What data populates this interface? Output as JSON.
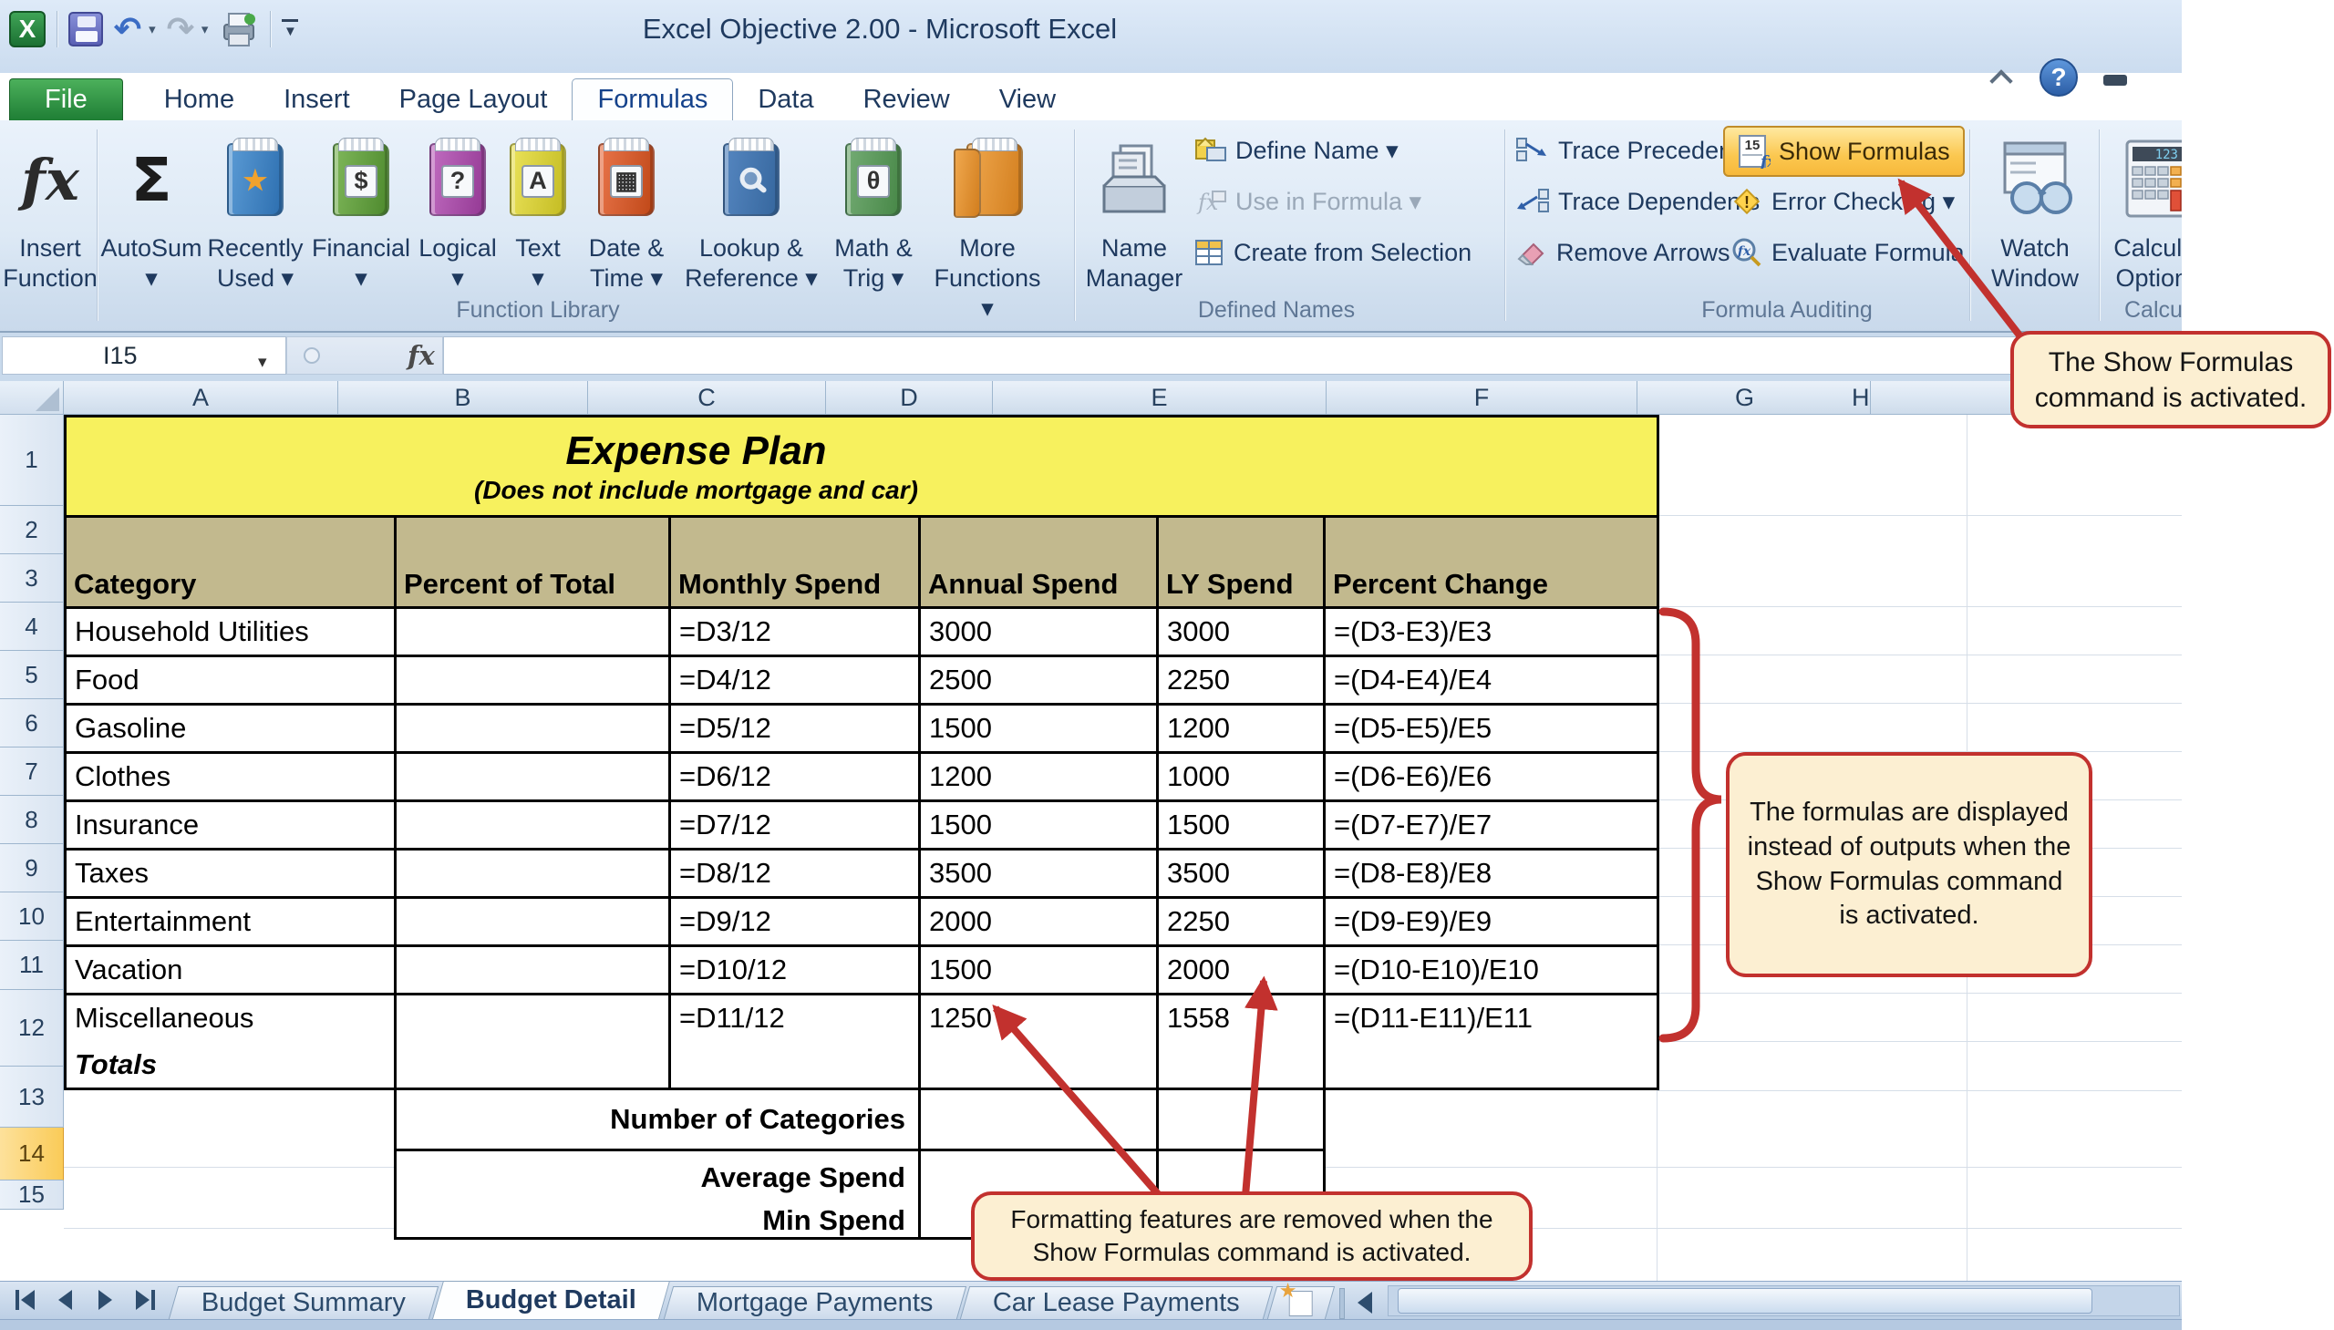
{
  "window": {
    "title": "Excel Objective 2.00  -  Microsoft Excel"
  },
  "qat": {
    "icons": [
      "excel-logo",
      "save",
      "undo",
      "redo",
      "print",
      "customize-quick-access-toolbar"
    ],
    "undo_glyph": "↶",
    "redo_glyph": "↷",
    "dropdown_glyph": "▾",
    "customize_glyph": "▼"
  },
  "ribbon": {
    "tabs": [
      {
        "label": "File",
        "active": false,
        "file": true
      },
      {
        "label": "Home",
        "active": false
      },
      {
        "label": "Insert",
        "active": false
      },
      {
        "label": "Page Layout",
        "active": false
      },
      {
        "label": "Formulas",
        "active": true
      },
      {
        "label": "Data",
        "active": false
      },
      {
        "label": "Review",
        "active": false
      },
      {
        "label": "View",
        "active": false
      }
    ],
    "function_library": {
      "group_label": "Function Library",
      "items": [
        {
          "l1": "Insert",
          "l2": "Function",
          "glyph": "fx",
          "icon": "insert-function-icon"
        },
        {
          "l1": "AutoSum",
          "l2": "▾",
          "glyph": "Σ",
          "icon": "autosum-icon"
        },
        {
          "l1": "Recently",
          "l2": "Used ▾",
          "glyph": "★",
          "icon": "recently-used-book-icon",
          "c1": "#5B9BD5",
          "c2": "#2D6FB0"
        },
        {
          "l1": "Financial",
          "l2": "▾",
          "glyph": "$",
          "icon": "financial-book-icon",
          "c1": "#7FB75A",
          "c2": "#4E8A2E"
        },
        {
          "l1": "Logical",
          "l2": "▾",
          "glyph": "?",
          "icon": "logical-book-icon",
          "c1": "#C06CC0",
          "c2": "#943994"
        },
        {
          "l1": "Text",
          "l2": "▾",
          "glyph": "A",
          "icon": "text-book-icon",
          "c1": "#EAE25A",
          "c2": "#C4BC22"
        },
        {
          "l1": "Date &",
          "l2": "Time ▾",
          "glyph": "▦",
          "icon": "date-time-book-icon",
          "c1": "#E8744A",
          "c2": "#C04818"
        },
        {
          "l1": "Lookup &",
          "l2": "Reference ▾",
          "glyph": "",
          "icon": "lookup-reference-book-icon",
          "c1": "#5586C0",
          "c2": "#36679E"
        },
        {
          "l1": "Math &",
          "l2": "Trig ▾",
          "glyph": "θ",
          "icon": "math-trig-book-icon",
          "c1": "#74AC74",
          "c2": "#478747"
        },
        {
          "l1": "More",
          "l2": "Functions ▾",
          "glyph": "",
          "icon": "more-functions-books-icon",
          "c1": "#F0A84E",
          "c2": "#D27E1E"
        }
      ]
    },
    "defined_names": {
      "group_label": "Defined Names",
      "big": {
        "l1": "Name",
        "l2": "Manager",
        "icon": "name-manager-icon"
      },
      "items": [
        {
          "label": "Define Name ▾",
          "disabled": false,
          "icon": "define-name-icon"
        },
        {
          "label": "Use in Formula ▾",
          "disabled": true,
          "icon": "use-in-formula-icon"
        },
        {
          "label": "Create from Selection",
          "disabled": false,
          "icon": "create-from-selection-icon"
        }
      ]
    },
    "formula_auditing": {
      "group_label": "Formula Auditing",
      "left": [
        "Trace Precedents",
        "Trace Dependents",
        "Remove Arrows ▾"
      ],
      "right": [
        "Show Formulas",
        "Error Checking ▾",
        "Evaluate Formula"
      ],
      "active_command": "Show Formulas"
    },
    "watch": {
      "l1": "Watch",
      "l2": "Window",
      "icon": "watch-window-icon"
    },
    "calculation": {
      "group_label": "Calcu",
      "l1": "Calculat",
      "l2": "Options",
      "icon": "calculation-options-icon"
    }
  },
  "formula_bar": {
    "name_box": "I15",
    "fx_label": "fx",
    "formula": "",
    "dropdown_glyph": "▾"
  },
  "sheet": {
    "columns": [
      "A",
      "B",
      "C",
      "D",
      "E",
      "F",
      "G",
      "H"
    ],
    "row_numbers": [
      "1",
      "2",
      "3",
      "4",
      "5",
      "6",
      "7",
      "8",
      "9",
      "10",
      "11",
      "12",
      "13",
      "14",
      "15"
    ],
    "active_cell": "I15",
    "title": "Expense Plan",
    "subtitle": "(Does not include mortgage and car)",
    "headers": [
      "Category",
      "Percent of Total",
      "Monthly Spend",
      "Annual Spend",
      "LY Spend",
      "Percent Change"
    ],
    "rows": [
      {
        "category": "Household Utilities",
        "percent": "",
        "monthly": "=D3/12",
        "annual": "3000",
        "ly": "3000",
        "change": "=(D3-E3)/E3"
      },
      {
        "category": "Food",
        "percent": "",
        "monthly": "=D4/12",
        "annual": "2500",
        "ly": "2250",
        "change": "=(D4-E4)/E4"
      },
      {
        "category": "Gasoline",
        "percent": "",
        "monthly": "=D5/12",
        "annual": "1500",
        "ly": "1200",
        "change": "=(D5-E5)/E5"
      },
      {
        "category": "Clothes",
        "percent": "",
        "monthly": "=D6/12",
        "annual": "1200",
        "ly": "1000",
        "change": "=(D6-E6)/E6"
      },
      {
        "category": "Insurance",
        "percent": "",
        "monthly": "=D7/12",
        "annual": "1500",
        "ly": "1500",
        "change": "=(D7-E7)/E7"
      },
      {
        "category": "Taxes",
        "percent": "",
        "monthly": "=D8/12",
        "annual": "3500",
        "ly": "3500",
        "change": "=(D8-E8)/E8"
      },
      {
        "category": "Entertainment",
        "percent": "",
        "monthly": "=D9/12",
        "annual": "2000",
        "ly": "2250",
        "change": "=(D9-E9)/E9"
      },
      {
        "category": "Vacation",
        "percent": "",
        "monthly": "=D10/12",
        "annual": "1500",
        "ly": "2000",
        "change": "=(D10-E10)/E10"
      },
      {
        "category": "Miscellaneous",
        "percent": "",
        "monthly": "=D11/12",
        "annual": "1250",
        "ly": "1558",
        "change": "=(D11-E11)/E11"
      }
    ],
    "totals_label": "Totals",
    "summary_rows": [
      {
        "label": "Number of Categories"
      },
      {
        "label": "Average Spend"
      },
      {
        "label": "Min Spend"
      }
    ]
  },
  "sheet_tabs": [
    {
      "label": "Budget Summary",
      "active": false
    },
    {
      "label": "Budget Detail",
      "active": true
    },
    {
      "label": "Mortgage Payments",
      "active": false
    },
    {
      "label": "Car Lease Payments",
      "active": false
    }
  ],
  "callouts": {
    "show_formulas": "The Show Formulas command is activated.",
    "formulas_displayed": "The formulas are displayed instead of outputs when the Show Formulas command is activated.",
    "formatting_removed": "Formatting features are removed when the Show Formulas command is activated."
  },
  "colors": {
    "annotation_red": "#C2312E",
    "callout_fill": "#FCEFD2",
    "show_formulas_highlight": "#FBC74F",
    "banner_yellow": "#F7F15E",
    "header_olive": "#C2B98E",
    "row15_highlight": "#FACB58",
    "file_tab_green": "#2E9B44"
  }
}
